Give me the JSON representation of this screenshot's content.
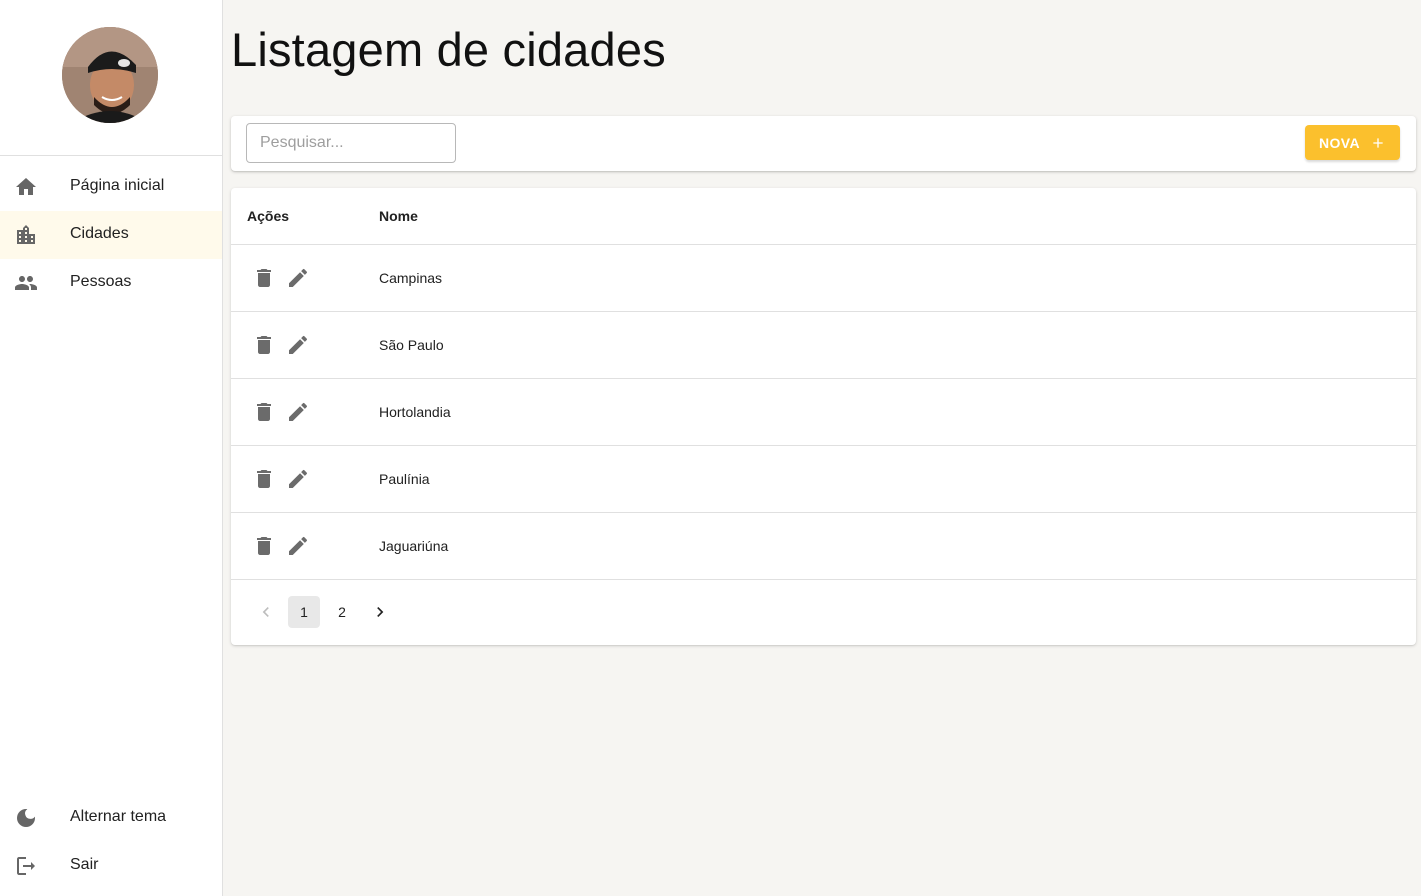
{
  "sidebar": {
    "avatar_alt": "Foto do usuário",
    "items": [
      {
        "label": "Página inicial",
        "icon": "home-icon"
      },
      {
        "label": "Cidades",
        "icon": "location-city-icon"
      },
      {
        "label": "Pessoas",
        "icon": "people-icon"
      }
    ],
    "bottom_items": [
      {
        "label": "Alternar tema",
        "icon": "dark-mode-icon"
      },
      {
        "label": "Sair",
        "icon": "logout-icon"
      }
    ]
  },
  "page": {
    "title": "Listagem de cidades"
  },
  "toolbar": {
    "search_placeholder": "Pesquisar...",
    "new_label": "NOVA"
  },
  "table": {
    "headers": [
      "Ações",
      "Nome"
    ],
    "rows": [
      {
        "name": "Campinas"
      },
      {
        "name": "São Paulo"
      },
      {
        "name": "Hortolandia"
      },
      {
        "name": "Paulínia"
      },
      {
        "name": "Jaguariúna"
      }
    ]
  },
  "pagination": {
    "pages": [
      "1",
      "2"
    ],
    "current": "1"
  },
  "colors": {
    "accent": "#fbc02d",
    "selected_bg": "#fffaeb",
    "background": "#f6f5f2"
  }
}
